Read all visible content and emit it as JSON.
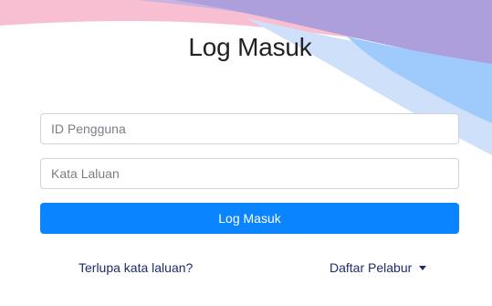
{
  "header": {
    "title": "Log Masuk"
  },
  "form": {
    "user_id_placeholder": "ID Pengguna",
    "user_id_value": "",
    "password_placeholder": "Kata Laluan",
    "password_value": "",
    "submit_label": "Log Masuk"
  },
  "links": {
    "forgot_password": "Terlupa kata laluan?",
    "register": "Daftar Pelabur"
  },
  "icons": {
    "register_dropdown": "caret-down-icon"
  },
  "colors": {
    "primary_button": "#0a84ff",
    "link_text": "#1f2d6b",
    "wave_pink": "#f8bfd3",
    "wave_purple": "#ad9fdc",
    "wave_blue_light": "#cfe0fb",
    "wave_blue": "#9ecbfb"
  }
}
